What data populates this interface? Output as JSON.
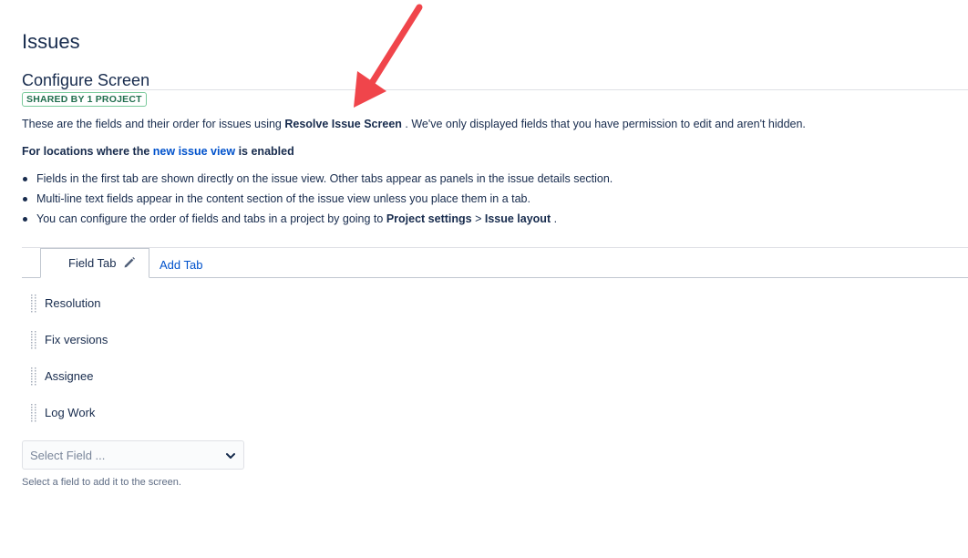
{
  "page": {
    "title": "Issues",
    "subtitle": "Configure Screen",
    "badge": "SHARED BY 1 PROJECT"
  },
  "description": {
    "prefix": "These are the fields and their order for issues using ",
    "screen_name": "Resolve Issue Screen",
    "suffix": " . We've only displayed fields that you have permission to edit and aren't hidden."
  },
  "locations": {
    "prefix": "For locations where the ",
    "link": "new issue view",
    "suffix": " is enabled"
  },
  "bullets": [
    "Fields in the first tab are shown directly on the issue view. Other tabs appear as panels in the issue details section.",
    "Multi-line text fields appear in the content section of the issue view unless you place them in a tab."
  ],
  "bullet3": {
    "prefix": "You can configure the order of fields and tabs in a project by going to ",
    "settings": "Project settings",
    "separator": " > ",
    "layout": "Issue layout",
    "suffix": " ."
  },
  "tabs": {
    "active": "Field Tab",
    "add": "Add Tab"
  },
  "fields": [
    "Resolution",
    "Fix versions",
    "Assignee",
    "Log Work"
  ],
  "select": {
    "placeholder": "Select Field ...",
    "hint": "Select a field to add it to the screen."
  },
  "colors": {
    "text": "#172b4d",
    "link": "#0052cc",
    "badge_border": "#79c99a",
    "badge_text": "#216e4e",
    "arrow": "#f0454b"
  },
  "icons": {
    "edit": "pencil-icon",
    "drag": "drag-handle-icon",
    "dropdown": "chevron-down-icon",
    "annotation": "arrow-annotation"
  }
}
